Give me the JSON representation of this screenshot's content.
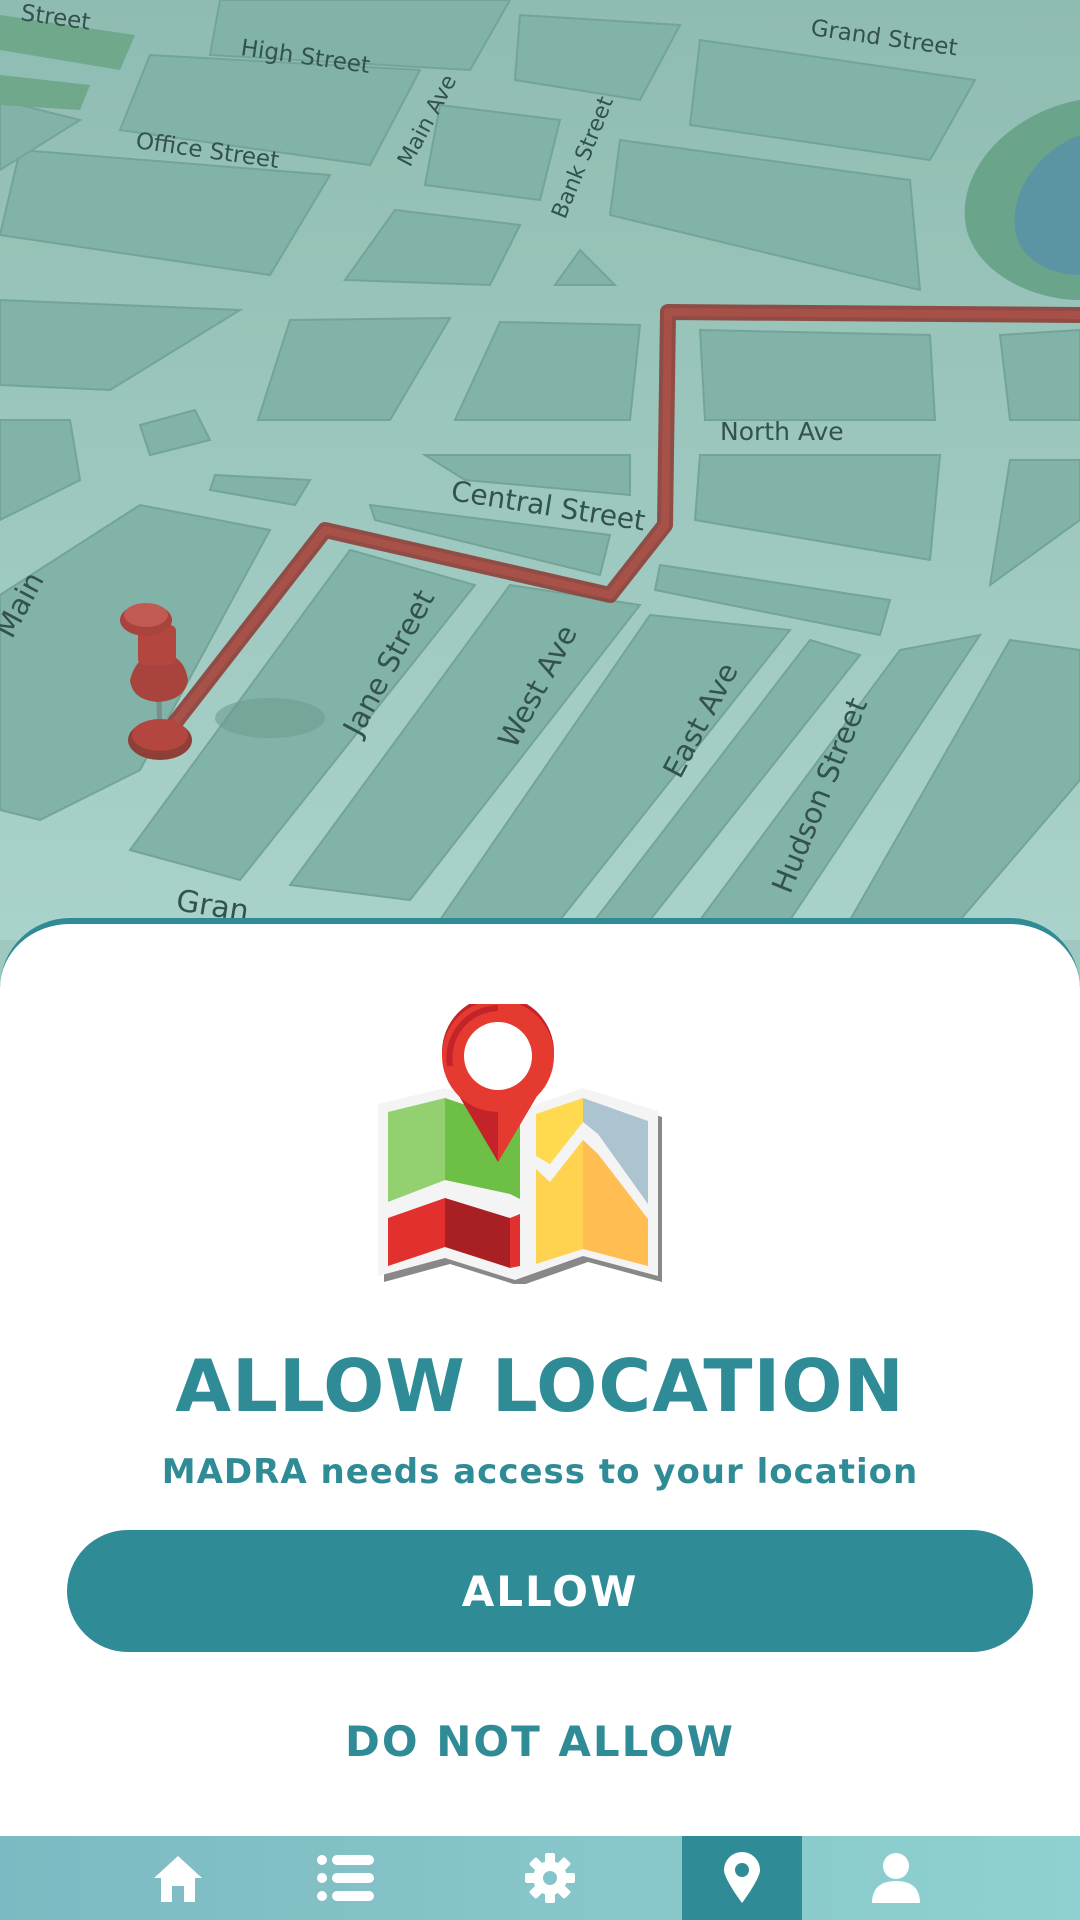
{
  "map": {
    "streets": {
      "high": "High Street",
      "grand_top": "Grand Street",
      "office": "Office Street",
      "main_ave": "Main Ave",
      "bank": "Bank Street",
      "north": "North Ave",
      "central": "Central Street",
      "jane": "Jane Street",
      "west": "West Ave",
      "east": "East Ave",
      "hudson": "Hudson Street",
      "grand_bottom": "Gran",
      "main_left": "Main",
      "street_top_left": "Street"
    },
    "route_color": "#a04a44",
    "pin_color": "#b3463f"
  },
  "dialog": {
    "title": "ALLOW LOCATION",
    "subtitle": "MADRA needs access to your location",
    "allow_label": "ALLOW",
    "deny_label": "DO NOT ALLOW",
    "illustration_icon": "folded-map-with-pin-icon"
  },
  "nav": {
    "items": [
      {
        "icon": "home-icon",
        "active": false
      },
      {
        "icon": "list-icon",
        "active": false
      },
      {
        "icon": "gear-icon",
        "active": false
      },
      {
        "icon": "location-pin-icon",
        "active": true
      },
      {
        "icon": "user-icon",
        "active": false
      }
    ],
    "active_color": "#2f8b95"
  },
  "colors": {
    "accent": "#2f8b95",
    "sheet_bg": "#ffffff"
  }
}
